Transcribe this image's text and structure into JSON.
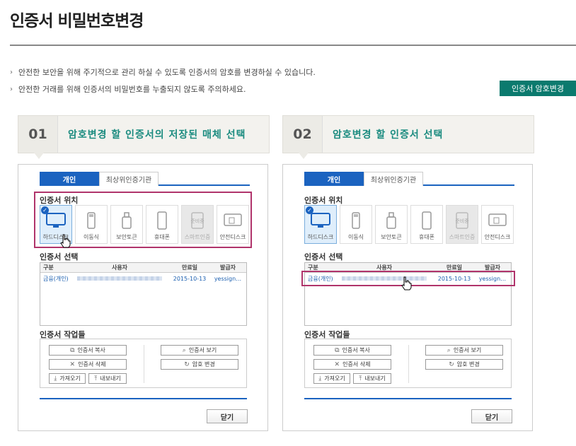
{
  "page": {
    "title": "인증서 비밀번호변경",
    "notes": [
      "안전한 보안을 위해 주기적으로 관리 하실 수 있도록 인증서의 암호를 변경하실 수 있습니다.",
      "안전한 거래를 위해 인증서의 비밀번호를 누출되지 않도록 주의하세요."
    ],
    "change_button": "인증서 암호변경"
  },
  "steps": [
    {
      "num": "01",
      "text": "암호변경 할 인증서의 저장된 매체 선택"
    },
    {
      "num": "02",
      "text": "암호변경 할 인증서 선택"
    }
  ],
  "dialog": {
    "tabs": [
      "개인",
      "최상위인증기관"
    ],
    "location_label": "인증서 위치",
    "devices": [
      {
        "label": "하드디스크",
        "icon": "monitor-icon"
      },
      {
        "label": "이동식",
        "icon": "usb-icon"
      },
      {
        "label": "보안토큰",
        "icon": "token-icon"
      },
      {
        "label": "휴대폰",
        "icon": "phone-icon"
      },
      {
        "label": "스마트인증",
        "icon": "smart-cert-icon",
        "overlay": "준비중"
      },
      {
        "label": "안전디스크",
        "icon": "safe-disk-icon"
      }
    ],
    "select_label": "인증서 선택",
    "columns": [
      "구분",
      "사용자",
      "만료일",
      "발급자"
    ],
    "rows": [
      {
        "type": "금융(개인)",
        "expiry": "2015-10-13",
        "issuer": "yessign…"
      }
    ],
    "ops_label": "인증서 작업들",
    "ops": {
      "copy": "인증서 복사",
      "view": "인증서 보기",
      "delete": "인증서 삭제",
      "change": "암호 변경",
      "import": "가져오기",
      "export": "내보내기"
    },
    "close": "닫기"
  },
  "colors": {
    "accent": "#0b7a6e",
    "step_text": "#1a8b7f",
    "tab_blue": "#1b63c0",
    "highlight": "#b0346b"
  }
}
